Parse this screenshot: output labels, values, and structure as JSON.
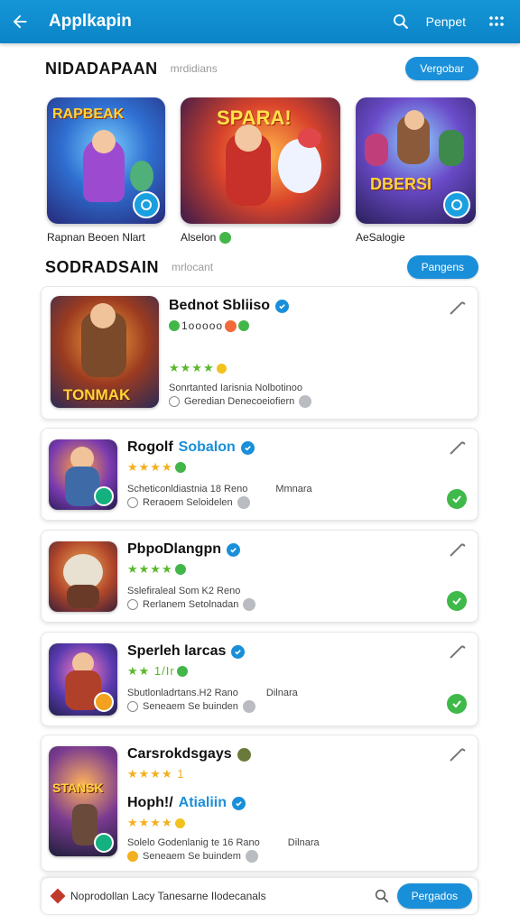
{
  "appbar": {
    "title": "Applkapin",
    "action_label": "Penpet"
  },
  "featured": {
    "heading": "NIDADAPAAN",
    "subheading": "mrdidians",
    "button_label": "Vergobar",
    "items": [
      {
        "label": "Rapnan Beoen Nlart",
        "art_text": "RAPBEAK"
      },
      {
        "label": "Alselon",
        "art_text": "SPARA!"
      },
      {
        "label": "AeSalogie",
        "art_text": "DBERSI"
      }
    ]
  },
  "list_section": {
    "heading": "SODRADSAIN",
    "subheading": "mrlocant",
    "button_label": "Pangens"
  },
  "cards": [
    {
      "title": "Bednot Sbliiso",
      "title_accent": "",
      "sub": "1ooooo",
      "rating": "★★★★",
      "meta1": "Sonrtanted Iarisnia Nolbotinoo",
      "meta1_extra": "",
      "meta2": "Geredian Denecoeiofiern",
      "thumb_text": "TONMAK",
      "status": "edit-only"
    },
    {
      "title": "Rogolf",
      "title_accent": "Sobalon",
      "sub": "",
      "rating": "★★★★",
      "meta1": "Scheticonldiastnia 18 Reno",
      "meta1_extra": "Mmnara",
      "meta2": "Reraoem Seloidelen",
      "thumb_text": "",
      "status": "checked"
    },
    {
      "title": "PbpoDlangpn",
      "title_accent": "",
      "sub": "",
      "rating": "★★★★",
      "meta1": "Sslefiraleal Som K2 Reno",
      "meta1_extra": "",
      "meta2": "Rerlanem Setolnadan",
      "thumb_text": "",
      "status": "checked"
    },
    {
      "title": "Sperleh larcas",
      "title_accent": "",
      "sub": "",
      "rating": "★★ 1/Ir",
      "meta1": "Sbutlonladrtans.H2 Rano",
      "meta1_extra": "Dilnara",
      "meta2": "Seneaem Se buinden",
      "thumb_text": "",
      "status": "checked"
    },
    {
      "title": "Carsrokdsgays",
      "title_accent": "",
      "sub": "",
      "rating": "★★★★ 1",
      "title2": "Hoph!/",
      "title2_accent": "Atialiin",
      "rating2": "★★★★",
      "meta1": "Solelo Godenlanig te 16 Rano",
      "meta1_extra": "Dilnara",
      "meta2": "Seneaem Se buindem",
      "thumb_text": "STANSK",
      "status": "edit-only"
    }
  ],
  "bottom_bar": {
    "text": "Noprodollan Lacy Tanesarne Ilodecanals",
    "button_label": "Pergados"
  }
}
